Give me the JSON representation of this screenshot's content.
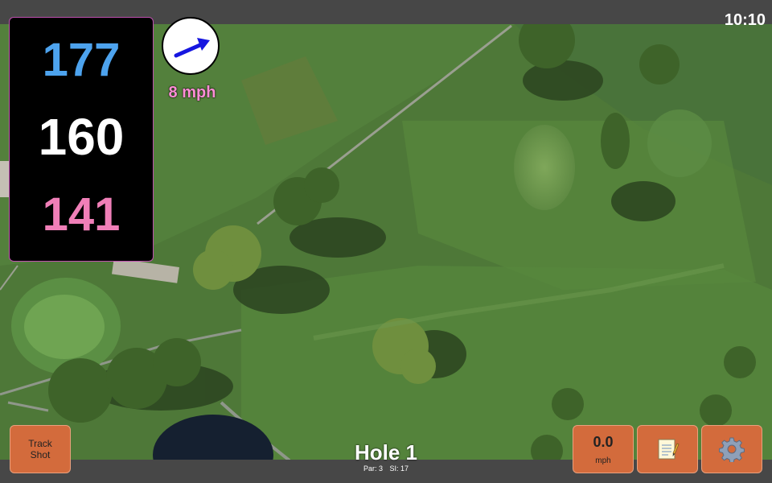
{
  "status": {
    "time": "10:10"
  },
  "yardages": {
    "back": "177",
    "middle": "160",
    "front": "141"
  },
  "wind": {
    "speed": "8 mph",
    "direction": "east-northeast"
  },
  "buttons": {
    "track_shot_line1": "Track",
    "track_shot_line2": "Shot",
    "speed_value": "0.0",
    "speed_unit": "mph",
    "notes_icon": "notepad-icon",
    "settings_icon": "gear-icon"
  },
  "hole": {
    "title": "Hole 1",
    "par": "Par: 3",
    "stroke_index": "SI: 17"
  },
  "colors": {
    "back_yardage": "#4da3ee",
    "middle_yardage": "#ffffff",
    "front_yardage": "#f07fb8",
    "wind_text": "#ff8ed6",
    "button_fill": "#d36b3c",
    "panel_border": "#c050b0"
  }
}
